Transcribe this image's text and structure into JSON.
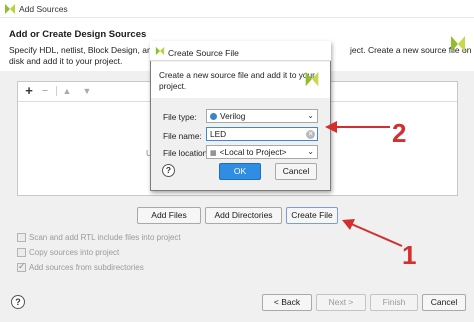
{
  "window": {
    "title": "Add Sources",
    "logo_icon": "vivado-logo-icon"
  },
  "header": {
    "title": "Add or Create Design Sources",
    "description_line1": "Specify HDL, netlist, Block Design, and IP files",
    "description_line1_tail": "ject. Create a new source file on",
    "description_line2": "disk and add it to your project."
  },
  "toolbar": {
    "add_icon": "plus-icon",
    "remove_icon": "minus-icon",
    "up_icon": "arrow-up-icon",
    "down_icon": "arrow-down-icon"
  },
  "panel": {
    "hint_partial": "U"
  },
  "source_buttons": {
    "add_files": "Add Files",
    "add_directories": "Add Directories",
    "create_file": "Create File"
  },
  "options": [
    {
      "label": "Scan and add RTL include files into project",
      "checked": false
    },
    {
      "label": "Copy sources into project",
      "checked": false
    },
    {
      "label": "Add sources from subdirectories",
      "checked": true
    }
  ],
  "footer": {
    "help": "?",
    "back": "< Back",
    "next": "Next >",
    "finish": "Finish",
    "cancel": "Cancel"
  },
  "dialog": {
    "title": "Create Source File",
    "description_line1": "Create a new source file and add it to your",
    "description_line2": "project.",
    "file_type_label": "File type:",
    "file_type_value": "Verilog",
    "file_name_label": "File name:",
    "file_name_value": "LED",
    "file_location_label": "File location:",
    "file_location_value": "<Local to Project>",
    "help": "?",
    "ok": "OK",
    "cancel": "Cancel"
  },
  "annotations": {
    "step1": "1",
    "step2": "2"
  },
  "colors": {
    "accent": "#2f8de3",
    "annotation": "#d32f2f",
    "xilinx_green": "#8fbf2a"
  }
}
